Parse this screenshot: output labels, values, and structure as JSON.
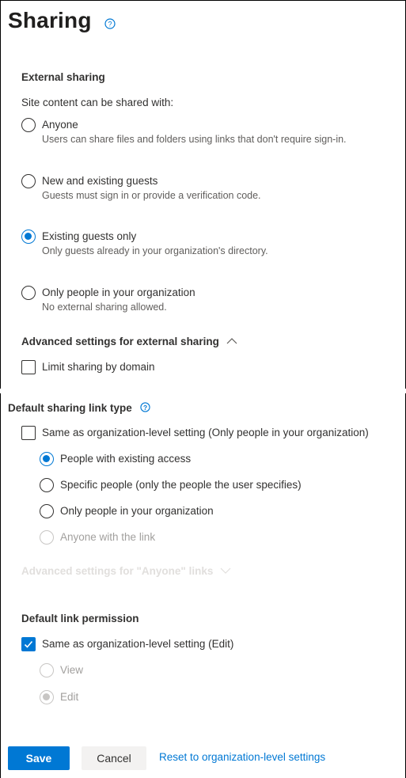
{
  "header": {
    "title": "Sharing"
  },
  "external_sharing": {
    "heading": "External sharing",
    "subheading": "Site content can be shared with:",
    "options": [
      {
        "label": "Anyone",
        "description": "Users can share files and folders using links that don't require sign-in.",
        "selected": false
      },
      {
        "label": "New and existing guests",
        "description": "Guests must sign in or provide a verification code.",
        "selected": false
      },
      {
        "label": "Existing guests only",
        "description": "Only guests already in your organization's directory.",
        "selected": true
      },
      {
        "label": "Only people in your organization",
        "description": "No external sharing allowed.",
        "selected": false
      }
    ],
    "advanced_label": "Advanced settings for external sharing",
    "limit_domain_label": "Limit sharing by domain"
  },
  "default_link_type": {
    "heading": "Default sharing link type",
    "same_as_org_label": "Same as organization-level setting (Only people in your organization)",
    "options": [
      {
        "label": "People with existing access",
        "selected": true,
        "disabled": false
      },
      {
        "label": "Specific people (only the people the user specifies)",
        "selected": false,
        "disabled": false
      },
      {
        "label": "Only people in your organization",
        "selected": false,
        "disabled": false
      },
      {
        "label": "Anyone with the link",
        "selected": false,
        "disabled": true
      }
    ],
    "anyone_advanced_label": "Advanced settings for \"Anyone\" links"
  },
  "default_link_permission": {
    "heading": "Default link permission",
    "same_as_org_label": "Same as organization-level setting (Edit)",
    "same_as_org_checked": true,
    "options": [
      {
        "label": "View",
        "selected": false
      },
      {
        "label": "Edit",
        "selected": true
      }
    ]
  },
  "footer": {
    "save_label": "Save",
    "cancel_label": "Cancel",
    "reset_label": "Reset to organization-level settings"
  },
  "colors": {
    "accent": "#0078d4",
    "text": "#323130",
    "disabled": "#c8c6c4"
  }
}
